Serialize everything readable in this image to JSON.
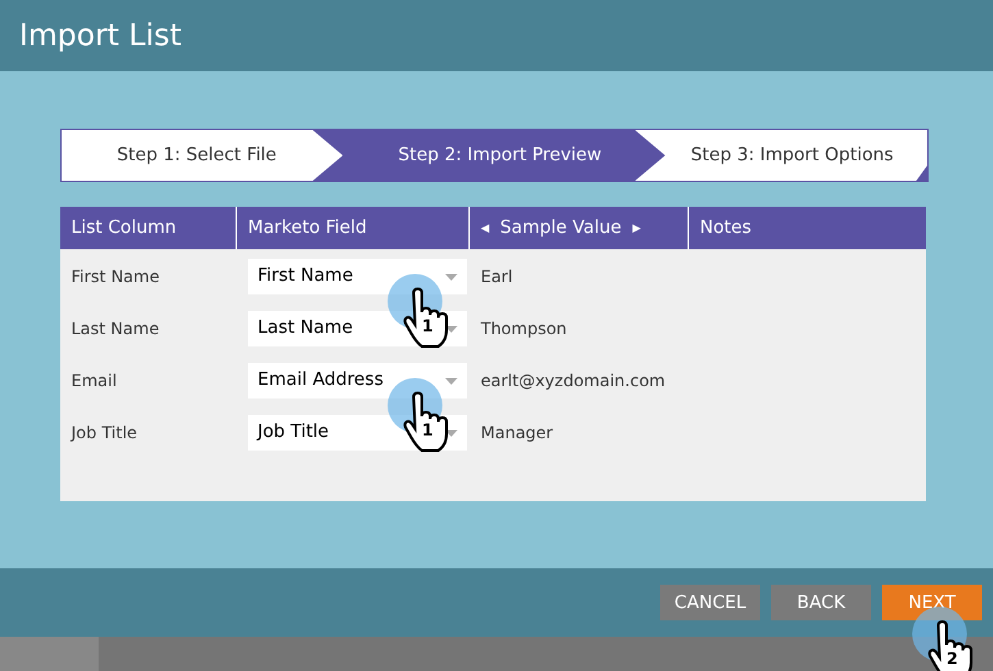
{
  "window": {
    "title": "Import List"
  },
  "steps": [
    {
      "label": "Step 1: Select File",
      "selected": false
    },
    {
      "label": "Step 2: Import Preview",
      "selected": true
    },
    {
      "label": "Step 3: Import Options",
      "selected": false
    }
  ],
  "table": {
    "columns": [
      {
        "label": "List Column",
        "kind": "plain"
      },
      {
        "label": "Marketo Field",
        "kind": "plain"
      },
      {
        "label": "Sample Value",
        "kind": "arrows",
        "prev": "◀",
        "next": "▶"
      },
      {
        "label": "Notes",
        "kind": "plain"
      }
    ],
    "rows": [
      {
        "list_column": "First Name",
        "marketo_field": "First Name",
        "sample_value": "Earl",
        "cursor": "1"
      },
      {
        "list_column": "Last Name",
        "marketo_field": "Last Name",
        "sample_value": "Thompson"
      },
      {
        "list_column": "Email",
        "marketo_field": "Email Address",
        "sample_value": "earlt@xyzdomain.com",
        "cursor": "1"
      },
      {
        "list_column": "Job Title",
        "marketo_field": "Job Title",
        "sample_value": "Manager"
      }
    ]
  },
  "buttons": [
    {
      "label": "CANCEL",
      "kind": "secondary"
    },
    {
      "label": "BACK",
      "kind": "secondary"
    },
    {
      "label": "NEXT",
      "kind": "primary",
      "cursor": "2"
    }
  ]
}
